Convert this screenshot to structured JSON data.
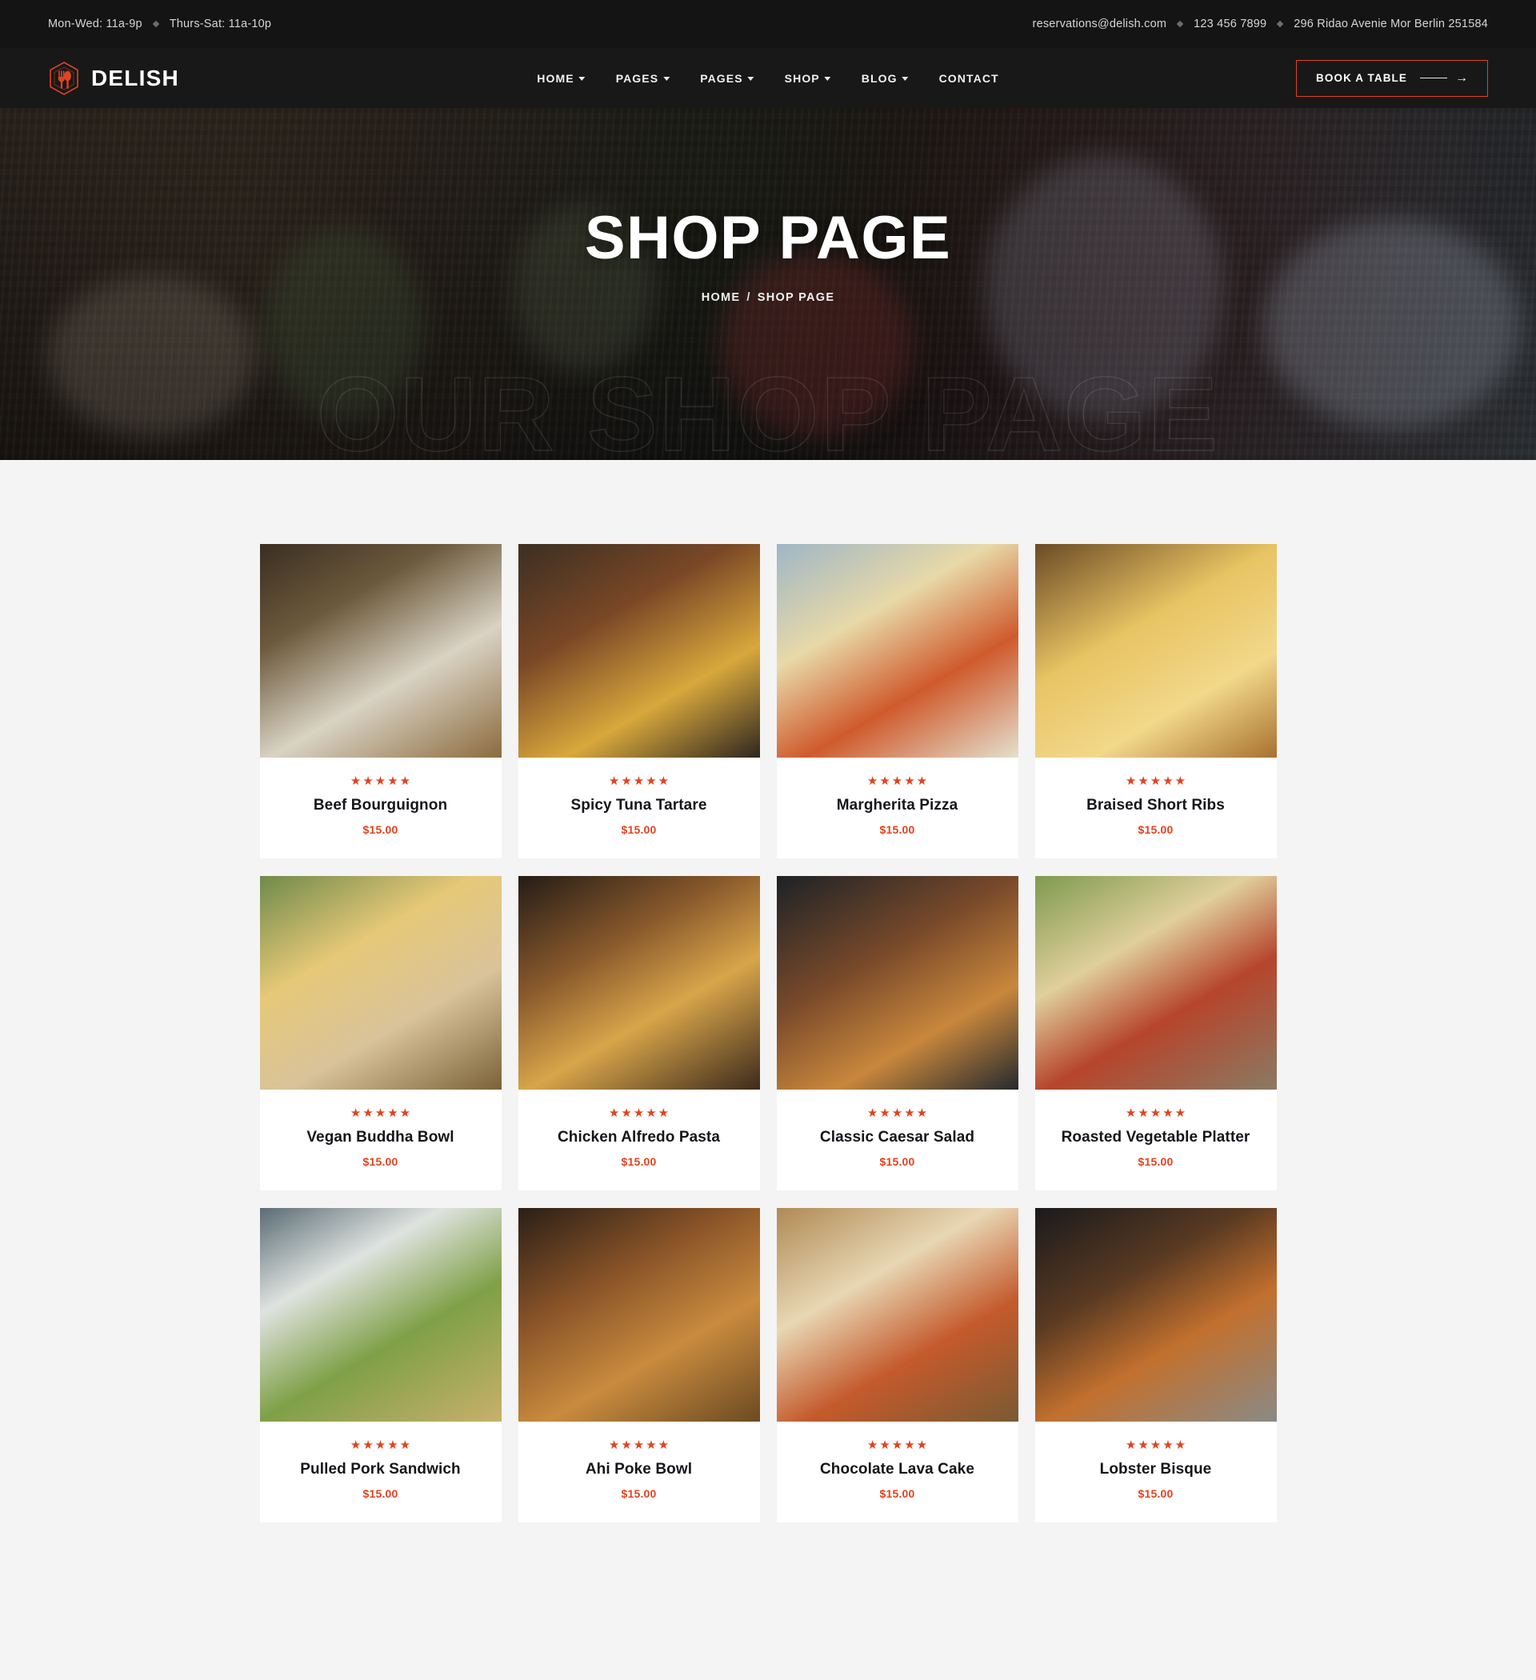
{
  "topbar": {
    "hours": [
      "Mon-Wed: 11a-9p",
      "Thurs-Sat: 11a-10p"
    ],
    "email": "reservations@delish.com",
    "phone": "123 456 7899",
    "address": "296 Ridao Avenie Mor Berlin 251584"
  },
  "header": {
    "brand": "DELISH",
    "logo_icon": "hexagon-fork-spoon-icon",
    "nav": [
      {
        "label": "HOME",
        "has_dropdown": true
      },
      {
        "label": "PAGES",
        "has_dropdown": true
      },
      {
        "label": "PAGES",
        "has_dropdown": true
      },
      {
        "label": "SHOP",
        "has_dropdown": true
      },
      {
        "label": "BLOG",
        "has_dropdown": true
      },
      {
        "label": "CONTACT",
        "has_dropdown": false
      }
    ],
    "cta": {
      "label": "BOOK A TABLE",
      "arrow_icon": "arrow-right-icon"
    }
  },
  "hero": {
    "title": "SHOP PAGE",
    "breadcrumb_home": "HOME",
    "breadcrumb_sep": "/",
    "breadcrumb_current": "SHOP PAGE",
    "watermark": "OUR SHOP PAGE"
  },
  "theme": {
    "accent": "#e0431f",
    "dark": "#181818",
    "topbar_bg": "#141414",
    "page_bg": "#f4f4f4",
    "card_bg": "#ffffff",
    "title_color": "#14161a"
  },
  "shop": {
    "rating_icon": "star-icon",
    "products": [
      {
        "name": "Beef Bourguignon",
        "price": "$15.00",
        "rating": 5
      },
      {
        "name": "Spicy Tuna Tartare",
        "price": "$15.00",
        "rating": 5
      },
      {
        "name": "Margherita Pizza",
        "price": "$15.00",
        "rating": 5
      },
      {
        "name": "Braised Short Ribs",
        "price": "$15.00",
        "rating": 5
      },
      {
        "name": "Vegan Buddha Bowl",
        "price": "$15.00",
        "rating": 5
      },
      {
        "name": "Chicken Alfredo Pasta",
        "price": "$15.00",
        "rating": 5
      },
      {
        "name": "Classic Caesar Salad",
        "price": "$15.00",
        "rating": 5
      },
      {
        "name": "Roasted Vegetable Platter",
        "price": "$15.00",
        "rating": 5
      },
      {
        "name": "Pulled Pork Sandwich",
        "price": "$15.00",
        "rating": 5
      },
      {
        "name": "Ahi Poke Bowl",
        "price": "$15.00",
        "rating": 5
      },
      {
        "name": "Chocolate Lava Cake",
        "price": "$15.00",
        "rating": 5
      },
      {
        "name": "Lobster Bisque",
        "price": "$15.00",
        "rating": 5
      }
    ]
  }
}
